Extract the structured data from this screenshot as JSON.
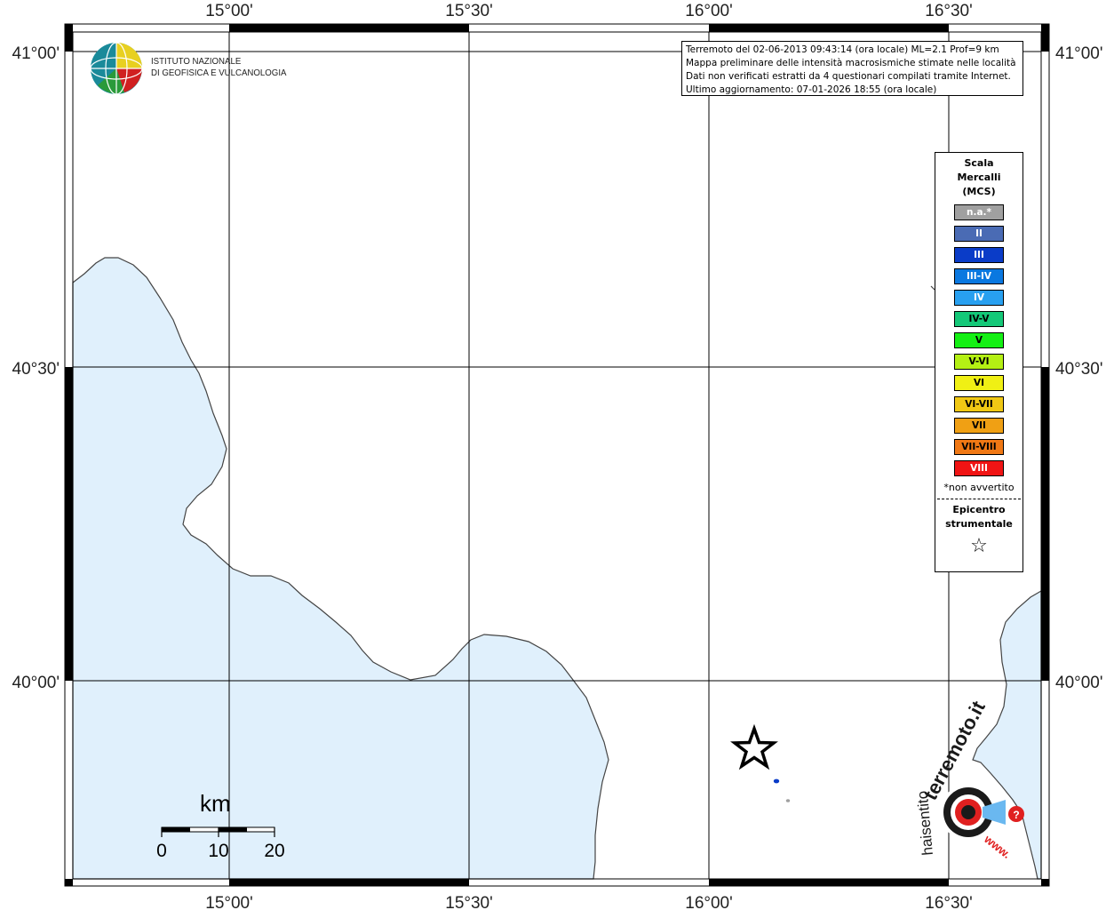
{
  "map": {
    "lon_labels": [
      "15°00'",
      "15°30'",
      "16°00'",
      "16°30'"
    ],
    "lat_labels": [
      "41°00'",
      "40°30'",
      "40°00'"
    ],
    "epicenter": {
      "symbol": "star"
    },
    "colors": {
      "sea": "#e0f0fc",
      "land": "#ffffff",
      "coast": "#444444",
      "grid": "#000000"
    }
  },
  "logo": {
    "line1": "ISTITUTO NAZIONALE",
    "line2": "DI GEOFISICA E VULCANOLOGIA"
  },
  "info": {
    "line1": "Terremoto del 02-06-2013 09:43:14 (ora locale) ML=2.1 Prof=9 km",
    "line2": "Mappa preliminare delle intensità macrosismiche stimate nelle località",
    "line3": "Dati non verificati estratti da 4 questionari compilati tramite Internet.",
    "line4": "Ultimo aggiornamento: 07-01-2026 18:55 (ora locale)"
  },
  "legend": {
    "title1": "Scala",
    "title2": "Mercalli",
    "title3": "(MCS)",
    "items": [
      {
        "label": "n.a.*",
        "color": "#a0a0a0",
        "text": "#ffffff"
      },
      {
        "label": "II",
        "color": "#4a6bb4",
        "text": "#ffffff"
      },
      {
        "label": "III",
        "color": "#0a3cc8",
        "text": "#ffffff"
      },
      {
        "label": "III-IV",
        "color": "#0a78e0",
        "text": "#ffffff"
      },
      {
        "label": "IV",
        "color": "#28a0f0",
        "text": "#ffffff"
      },
      {
        "label": "IV-V",
        "color": "#14c878",
        "text": "#000000"
      },
      {
        "label": "V",
        "color": "#14f014",
        "text": "#000000"
      },
      {
        "label": "V-VI",
        "color": "#b4f014",
        "text": "#000000"
      },
      {
        "label": "VI",
        "color": "#f0f014",
        "text": "#000000"
      },
      {
        "label": "VI-VII",
        "color": "#f0c814",
        "text": "#000000"
      },
      {
        "label": "VII",
        "color": "#f0a014",
        "text": "#000000"
      },
      {
        "label": "VII-VIII",
        "color": "#f07814",
        "text": "#000000"
      },
      {
        "label": "VIII",
        "color": "#f01414",
        "text": "#ffffff"
      }
    ],
    "note": "*non avvertito",
    "epicentro1": "Epicentro",
    "epicentro2": "strumentale",
    "star_symbol": "☆"
  },
  "scalebar": {
    "unit": "km",
    "ticks": [
      "0",
      "10",
      "20"
    ]
  },
  "hsit_logo": {
    "top_text": "terremoto.it",
    "left_text": "haisentito",
    "bottom_text": "www."
  }
}
